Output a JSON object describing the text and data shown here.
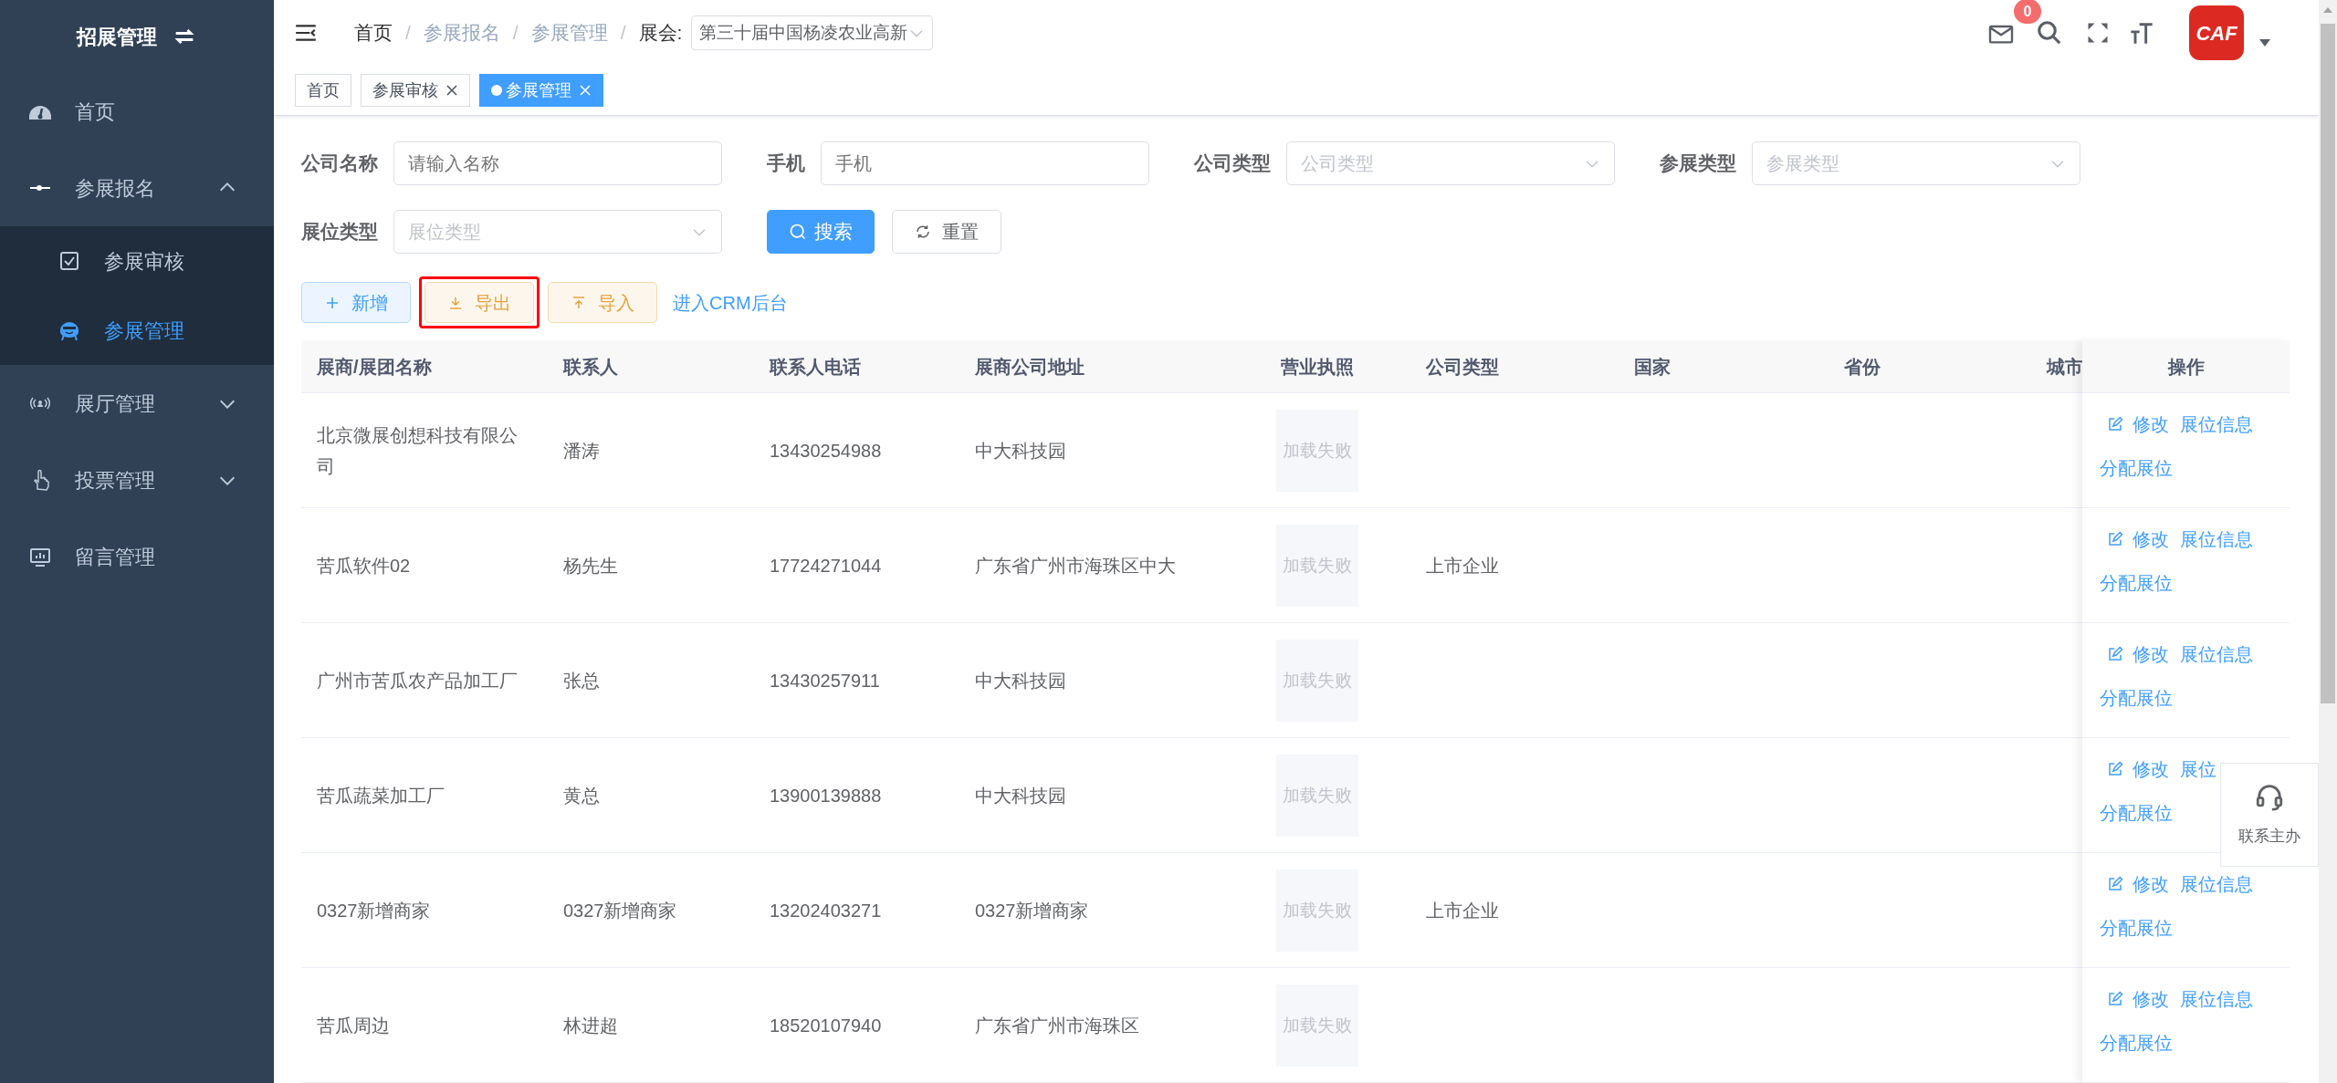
{
  "sidebar": {
    "title": "招展管理",
    "items": [
      {
        "label": "首页",
        "selected": false
      },
      {
        "label": "参展报名",
        "selected": false,
        "expanded": true,
        "children": [
          {
            "label": "参展审核",
            "selected": false
          },
          {
            "label": "参展管理",
            "selected": true
          }
        ]
      },
      {
        "label": "展厅管理",
        "selected": false,
        "expanded": false
      },
      {
        "label": "投票管理",
        "selected": false,
        "expanded": false
      },
      {
        "label": "留言管理",
        "selected": false
      }
    ]
  },
  "header": {
    "breadcrumb": [
      {
        "label": "首页",
        "link": true,
        "separator": "/"
      },
      {
        "label": "参展报名",
        "link": false,
        "separator": "/"
      },
      {
        "label": "参展管理",
        "link": false,
        "separator": "/"
      }
    ],
    "exhibition_label": "展会:",
    "exhibition_value": "第三十届中国杨凌农业高新",
    "message_count": "0",
    "logo_text": "CAF"
  },
  "tags": [
    {
      "label": "首页",
      "selected": false,
      "closable": false
    },
    {
      "label": "参展审核",
      "selected": false,
      "closable": true
    },
    {
      "label": "参展管理",
      "selected": true,
      "closable": true
    }
  ],
  "filters": [
    {
      "label": "公司名称",
      "kind": "input",
      "placeholder": "请输入名称"
    },
    {
      "label": "手机",
      "kind": "input",
      "placeholder": "手机"
    },
    {
      "label": "公司类型",
      "kind": "select",
      "placeholder": "公司类型"
    },
    {
      "label": "参展类型",
      "kind": "select",
      "placeholder": "参展类型"
    },
    {
      "label": "展位类型",
      "kind": "select",
      "placeholder": "展位类型"
    }
  ],
  "search_button": "搜索",
  "reset_button": "重置",
  "toolbar": [
    {
      "label": "新增",
      "kind": "add",
      "highlighted": false
    },
    {
      "label": "导出",
      "kind": "export",
      "highlighted": true
    },
    {
      "label": "导入",
      "kind": "import",
      "highlighted": false
    }
  ],
  "crm_link": "进入CRM后台",
  "table": {
    "columns": [
      "展商/展团名称",
      "联系人",
      "联系人电话",
      "展商公司地址",
      "营业执照",
      "公司类型",
      "国家",
      "省份",
      "城市"
    ],
    "action_column": "操作",
    "rows": [
      {
        "company": "北京微展创想科技有限公司",
        "contact": "潘涛",
        "phone": "13430254988",
        "address": "中大科技园",
        "license": "加载失败",
        "actions": [
          "修改",
          "展位信息",
          "分配展位"
        ]
      },
      {
        "company": "苦瓜软件02",
        "contact": "杨先生",
        "phone": "17724271044",
        "address": "广东省广州市海珠区中大",
        "license": "加载失败",
        "company_type": "上市企业",
        "actions": [
          "修改",
          "展位信息",
          "分配展位"
        ]
      },
      {
        "company": "广州市苦瓜农产品加工厂",
        "contact": "张总",
        "phone": "13430257911",
        "address": "中大科技园",
        "license": "加载失败",
        "actions": [
          "修改",
          "展位信息",
          "分配展位"
        ]
      },
      {
        "company": "苦瓜蔬菜加工厂",
        "contact": "黄总",
        "phone": "13900139888",
        "address": "中大科技园",
        "license": "加载失败",
        "actions": [
          "修改",
          "展位",
          "分配展位"
        ]
      },
      {
        "company": "0327新增商家",
        "contact": "0327新增商家",
        "phone": "13202403271",
        "address": "0327新增商家",
        "license": "加载失败",
        "company_type": "上市企业",
        "actions": [
          "修改",
          "展位信息",
          "分配展位"
        ]
      },
      {
        "company": "苦瓜周边",
        "contact": "林进超",
        "phone": "18520107940",
        "address": "广东省广州市海珠区",
        "license": "加载失败",
        "actions": [
          "修改",
          "展位信息",
          "分配展位"
        ]
      }
    ]
  },
  "contact_widget": {
    "label": "联系主办"
  }
}
